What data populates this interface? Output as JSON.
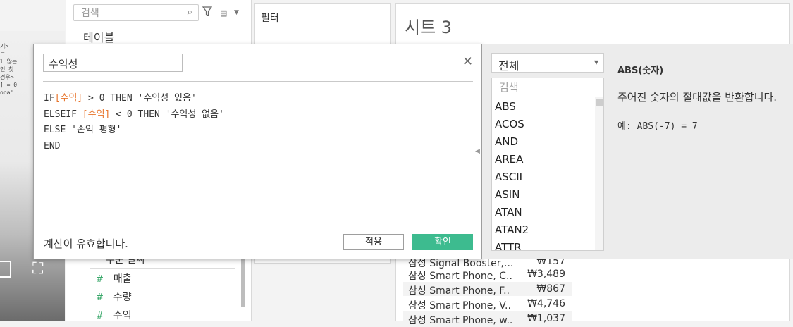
{
  "left_video": {
    "code_lines": [
      "기>",
      "는",
      "l 않는",
      "",
      "",
      "인 첫",
      "경우>",
      "",
      "",
      "] = 0",
      "ooa'"
    ]
  },
  "data_pane": {
    "search_placeholder": "검색",
    "tables_label": "테이블",
    "fields": [
      {
        "name": "주문 날짜"
      },
      {
        "name": "매출"
      },
      {
        "name": "수량"
      },
      {
        "name": "수익"
      }
    ]
  },
  "filters": {
    "label": "필터"
  },
  "sheet": {
    "title": "시트 3",
    "rows": [
      {
        "name": "삼성 Signal Booster,...",
        "value": "₩157"
      },
      {
        "name": "삼성 Smart Phone, C..",
        "value": "₩3,489"
      },
      {
        "name": "삼성 Smart Phone, F..",
        "value": "₩867"
      },
      {
        "name": "삼성 Smart Phone, V..",
        "value": "₩4,746"
      },
      {
        "name": "삼성 Smart Phone, w..",
        "value": "₩1,037"
      }
    ]
  },
  "calc_dialog": {
    "name": "수익성",
    "formula": {
      "l1_a": "IF",
      "l1_field": "[수익]",
      "l1_b": " > 0 THEN '수익성 있음'",
      "l2_a": "ELSEIF ",
      "l2_field": "[수익]",
      "l2_b": " < 0 THEN '수익성 없음'",
      "l3": "ELSE '손익 평형'",
      "l4": "END"
    },
    "status": "계산이 유효합니다.",
    "apply_label": "적용",
    "ok_label": "확인",
    "close_glyph": "✕",
    "collapse_glyph": "◀"
  },
  "func_panel": {
    "category": "전체",
    "search_placeholder": "검색",
    "functions": [
      "ABS",
      "ACOS",
      "AND",
      "AREA",
      "ASCII",
      "ASIN",
      "ATAN",
      "ATAN2",
      "ATTR"
    ],
    "selected_signature": "ABS(숫자)",
    "description": "주어진 숫자의 절대값을 반환합니다.",
    "example": "예: ABS(-7) = 7"
  },
  "colors": {
    "accent_green": "#3dbb8f",
    "field_orange": "#e8742b",
    "measure_green": "#3aa86b"
  }
}
